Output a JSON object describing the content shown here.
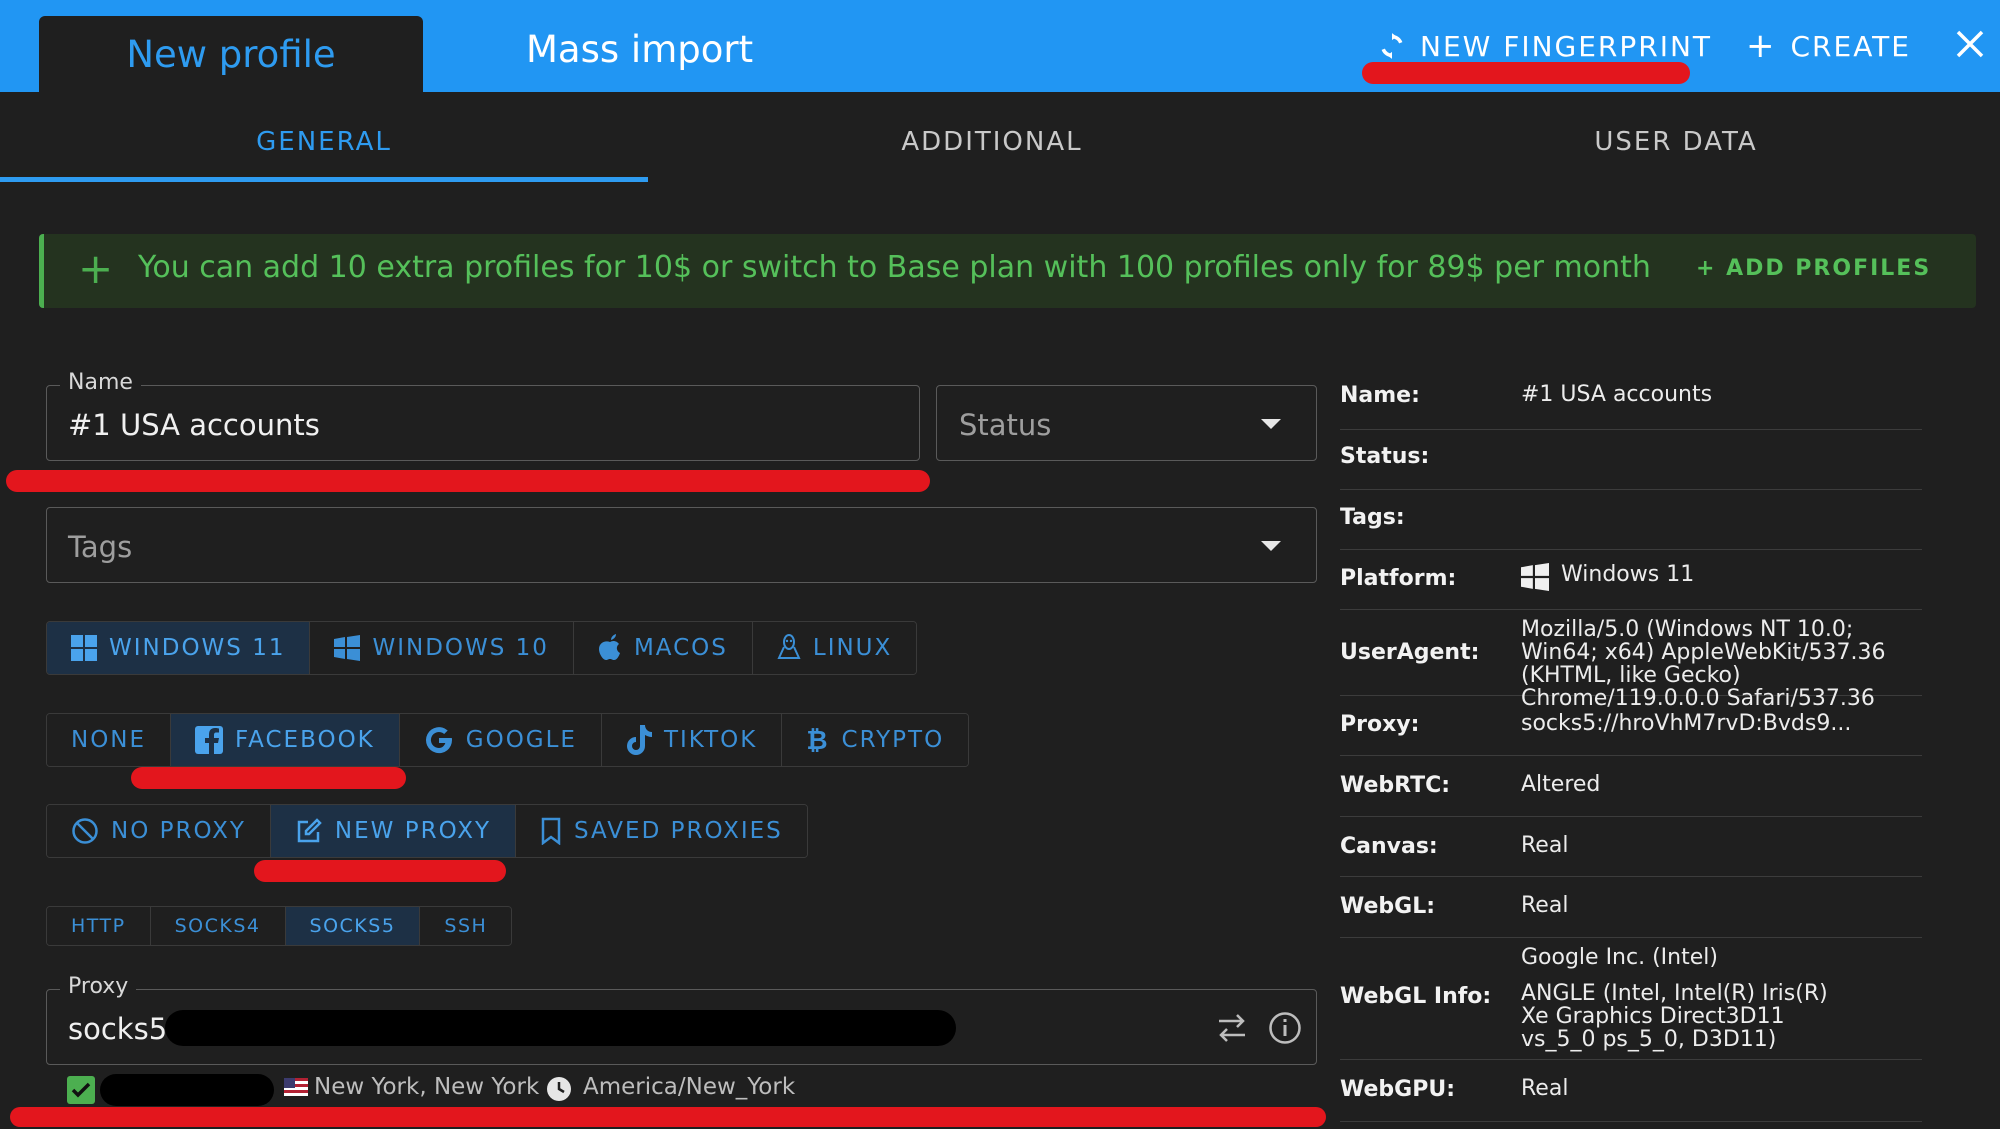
{
  "header": {
    "tabs": [
      {
        "label": "New profile",
        "active": true
      },
      {
        "label": "Mass import",
        "active": false
      }
    ],
    "actions": {
      "new_fingerprint": "NEW FINGERPRINT",
      "create": "CREATE"
    }
  },
  "subtabs": [
    "GENERAL",
    "ADDITIONAL",
    "USER DATA"
  ],
  "banner": {
    "text": "You can add 10 extra profiles for 10$ or switch to Base plan with 100 profiles only for 89$ per month",
    "button": "+ ADD PROFILES"
  },
  "form": {
    "name_label": "Name",
    "name_value": "#1 USA accounts",
    "status_placeholder": "Status",
    "tags_placeholder": "Tags",
    "os_options": [
      {
        "label": "WINDOWS 11",
        "selected": true,
        "icon": "windows-icon"
      },
      {
        "label": "WINDOWS 10",
        "selected": false,
        "icon": "windows-icon"
      },
      {
        "label": "MACOS",
        "selected": false,
        "icon": "apple-icon"
      },
      {
        "label": "LINUX",
        "selected": false,
        "icon": "linux-icon"
      }
    ],
    "template_options": [
      {
        "label": "NONE",
        "selected": false
      },
      {
        "label": "FACEBOOK",
        "selected": true,
        "icon": "facebook-icon"
      },
      {
        "label": "GOOGLE",
        "selected": false,
        "icon": "google-icon"
      },
      {
        "label": "TIKTOK",
        "selected": false,
        "icon": "tiktok-icon"
      },
      {
        "label": "CRYPTO",
        "selected": false,
        "icon": "bitcoin-icon"
      }
    ],
    "proxy_mode_options": [
      {
        "label": "NO PROXY",
        "selected": false,
        "icon": "block-icon"
      },
      {
        "label": "NEW PROXY",
        "selected": true,
        "icon": "edit-icon"
      },
      {
        "label": "SAVED PROXIES",
        "selected": false,
        "icon": "bookmark-icon"
      }
    ],
    "proxy_types": [
      {
        "label": "HTTP",
        "selected": false
      },
      {
        "label": "SOCKS4",
        "selected": false
      },
      {
        "label": "SOCKS5",
        "selected": true
      },
      {
        "label": "SSH",
        "selected": false
      }
    ],
    "proxy_label": "Proxy",
    "proxy_value_prefix": "socks5.",
    "proxy_location": "New York, New York",
    "proxy_timezone": "America/New_York"
  },
  "summary": [
    {
      "key": "Name:",
      "value": "#1 USA accounts"
    },
    {
      "key": "Status:",
      "value": ""
    },
    {
      "key": "Tags:",
      "value": ""
    },
    {
      "key": "Platform:",
      "value": "Windows 11"
    },
    {
      "key": "UserAgent:",
      "value": "Mozilla/5.0 (Windows NT 10.0; Win64; x64) AppleWebKit/537.36 (KHTML, like Gecko) Chrome/119.0.0.0 Safari/537.36"
    },
    {
      "key": "Proxy:",
      "value": "socks5://hroVhM7rvD:Bvds9..."
    },
    {
      "key": "WebRTC:",
      "value": "Altered"
    },
    {
      "key": "Canvas:",
      "value": "Real"
    },
    {
      "key": "WebGL:",
      "value": "Real"
    },
    {
      "key": "WebGL Info:",
      "value": "Google Inc. (Intel)",
      "value2": "ANGLE (Intel, Intel(R) Iris(R) Xe Graphics Direct3D11 vs_5_0 ps_5_0, D3D11)"
    },
    {
      "key": "WebGPU:",
      "value": "Real"
    }
  ],
  "colors": {
    "accent": "#2196f3",
    "background": "#1f1f1f",
    "banner_green": "#55c05a",
    "highlight_red": "#e3161d"
  }
}
